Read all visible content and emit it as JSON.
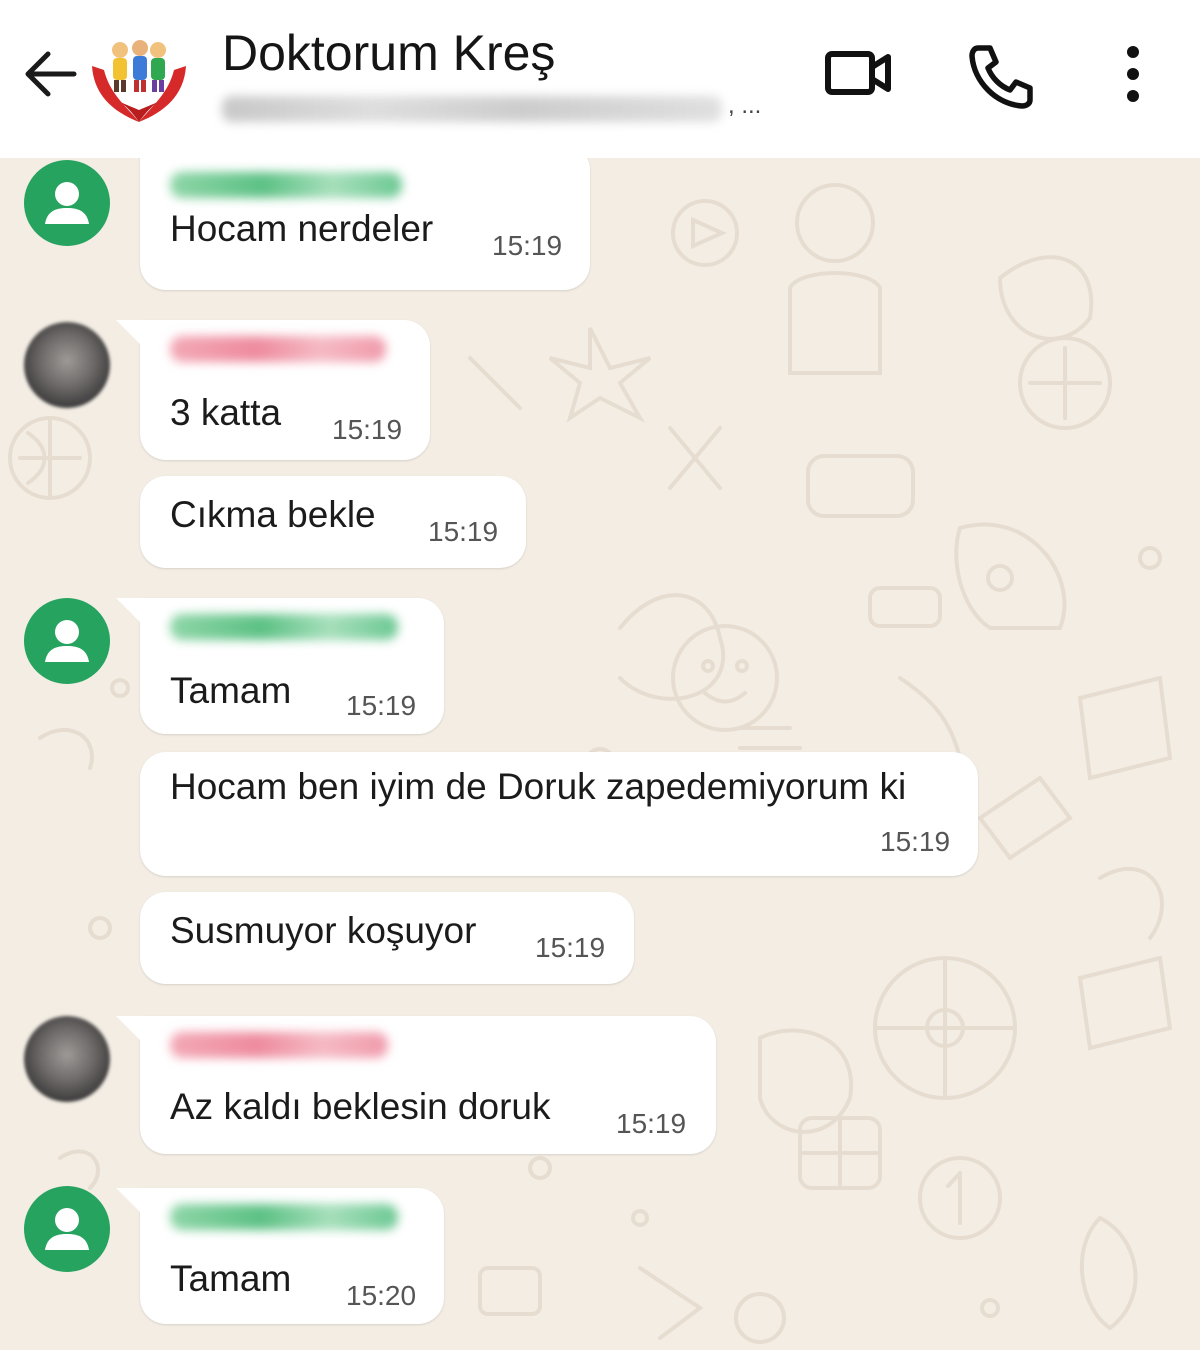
{
  "header": {
    "title": "Doktorum Kreş",
    "subtitle_suffix": ", ...",
    "icons": [
      "back-arrow-icon",
      "group-logo",
      "video-call-icon",
      "voice-call-icon",
      "more-options-icon"
    ]
  },
  "colors": {
    "header_bg": "#ffffff",
    "chat_bg": "#f3ede4",
    "bubble_bg": "#ffffff",
    "avatar_green": "#25a35f",
    "sender_green": "#5cc184",
    "sender_red": "#ee8b9e"
  },
  "messages": [
    {
      "text": "Hocam nerdeler",
      "time": "15:19"
    },
    {
      "text": "3 katta",
      "time": "15:19"
    },
    {
      "text": "Cıkma bekle",
      "time": "15:19"
    },
    {
      "text": "Tamam",
      "time": "15:19"
    },
    {
      "text": "Hocam ben iyim de Doruk zapedemiyorum ki",
      "time": "15:19"
    },
    {
      "text": "Susmuyor koşuyor",
      "time": "15:19"
    },
    {
      "text": "Az kaldı beklesin doruk",
      "time": "15:19"
    },
    {
      "text": "Tamam",
      "time": "15:20"
    }
  ]
}
